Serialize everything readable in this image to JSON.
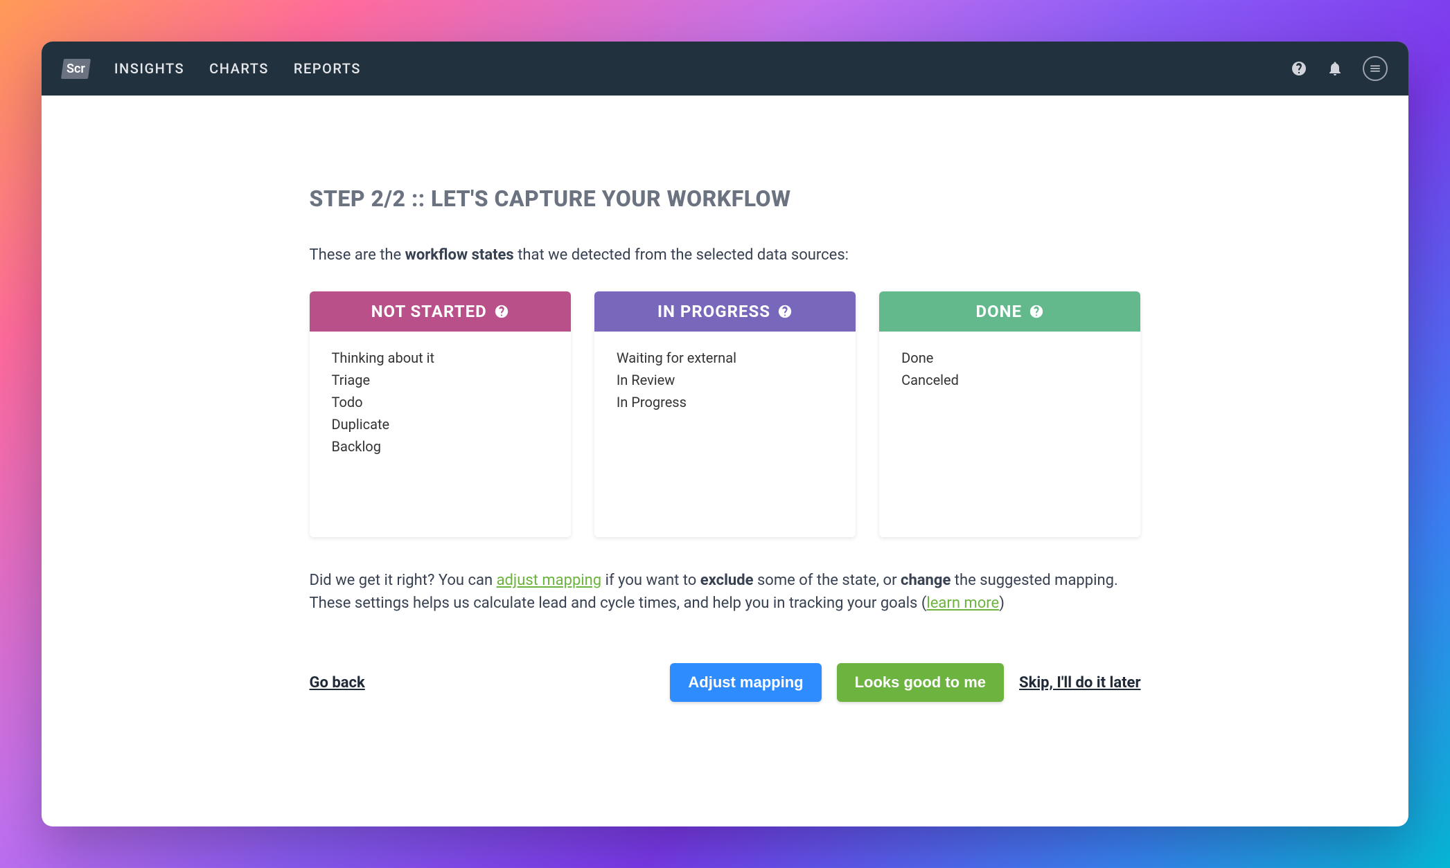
{
  "nav": {
    "logo": "Scr",
    "links": [
      "INSIGHTS",
      "CHARTS",
      "REPORTS"
    ]
  },
  "step": {
    "title": "STEP 2/2 :: LET'S CAPTURE YOUR WORKFLOW",
    "intro_prefix": "These are the ",
    "intro_bold": "workflow states",
    "intro_suffix": " that we detected from the selected data sources:"
  },
  "columns": {
    "not_started": {
      "title": "NOT STARTED",
      "items": [
        "Thinking about it",
        "Triage",
        "Todo",
        "Duplicate",
        "Backlog"
      ]
    },
    "in_progress": {
      "title": "IN PROGRESS",
      "items": [
        "Waiting for external",
        "In Review",
        "In Progress"
      ]
    },
    "done": {
      "title": "DONE",
      "items": [
        "Done",
        "Canceled"
      ]
    }
  },
  "bottom": {
    "seg1": "Did we get it right? You can ",
    "link1": "adjust mapping",
    "seg2": " if you want to ",
    "bold1": "exclude",
    "seg3": " some of the state, or ",
    "bold2": "change",
    "seg4": " the suggested mapping. These settings helps us calculate lead and cycle times, and help you in tracking your goals (",
    "link2": "learn more",
    "seg5": ")"
  },
  "actions": {
    "go_back": "Go back",
    "adjust": "Adjust mapping",
    "looks_good": "Looks good to me",
    "skip": "Skip, I'll do it later"
  }
}
